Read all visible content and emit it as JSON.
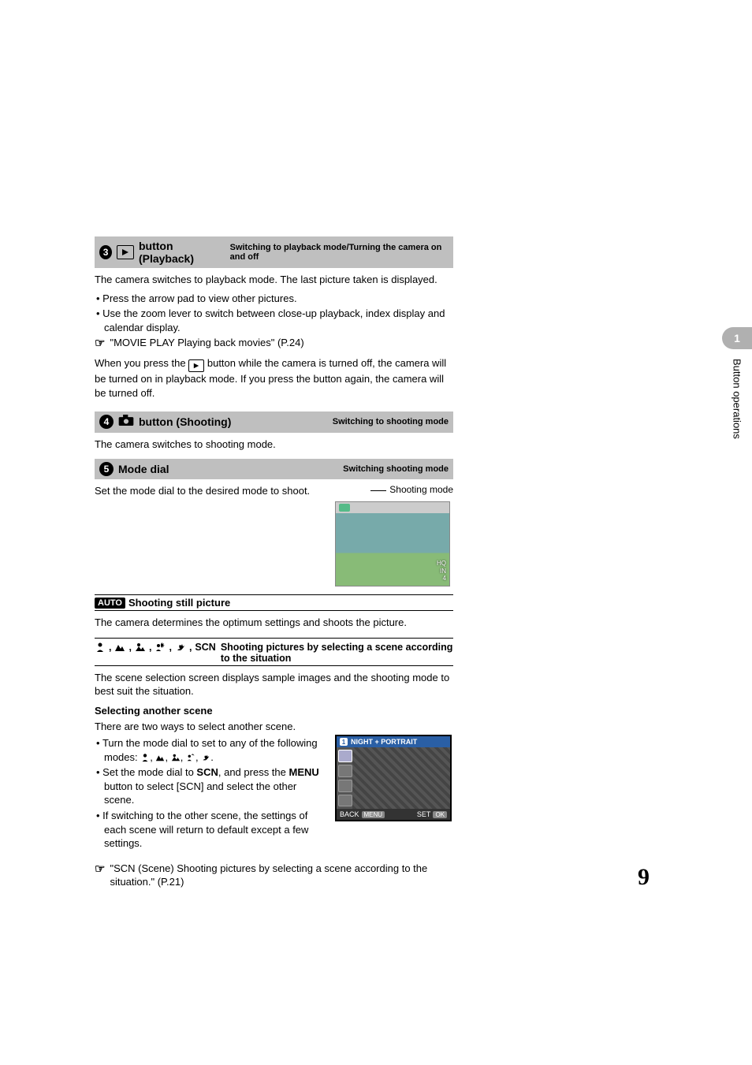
{
  "side": {
    "chapter": "1",
    "label": "Button operations"
  },
  "sec3": {
    "num": "3",
    "title": "button (Playback)",
    "sub": "Switching to playback mode/Turning the camera on and off",
    "p1": "The camera switches to playback mode. The last picture taken is displayed.",
    "b1": "Press the arrow pad to view other pictures.",
    "b2": "Use the zoom lever to switch between close-up playback, index display and calendar display.",
    "ref1": "\"MOVIE PLAY Playing back movies\" (P.24)",
    "p2a": "When you press the ",
    "p2b": " button while the camera is turned off, the camera will be turned on in playback mode. If you press the button again, the camera will be turned off."
  },
  "sec4": {
    "num": "4",
    "title": "button (Shooting)",
    "sub": "Switching to shooting mode",
    "p1": "The camera switches to shooting mode."
  },
  "sec5": {
    "num": "5",
    "title": "Mode dial",
    "sub": "Switching shooting mode",
    "p1": "Set the mode dial to the desired mode to shoot.",
    "label": "Shooting mode",
    "hud": {
      "l1": "HQ",
      "l2": "IN",
      "l3": "4"
    }
  },
  "auto": {
    "tag": "AUTO",
    "title": "Shooting still picture",
    "p1": "The camera determines the optimum settings and shoots the picture."
  },
  "scene": {
    "title": "Shooting pictures by selecting a scene according to the situation",
    "scn": "SCN",
    "p1": "The scene selection screen displays sample images and the shooting mode to best suit the situation.",
    "h2": "Selecting another scene",
    "p2": "There are two ways to select another scene.",
    "b1": "Turn the mode dial to set to any of the following modes: ",
    "b2a": "Set the mode dial to ",
    "b2b": ", and press the ",
    "b2c": " button to select [SCN] and select the other scene.",
    "scn_bold": "SCN",
    "menu_bold": "MENU",
    "b3": "If switching to the other scene, the settings of each scene will return to default except a few settings.",
    "ref": "\"SCN (Scene)  Shooting pictures by selecting a scene according to the situation.\" (P.21)"
  },
  "lcd": {
    "header_num": "1",
    "header_text": "NIGHT + PORTRAIT",
    "back": "BACK",
    "back_btn": "MENU",
    "set": "SET",
    "set_btn": "OK"
  },
  "page_num": "9"
}
